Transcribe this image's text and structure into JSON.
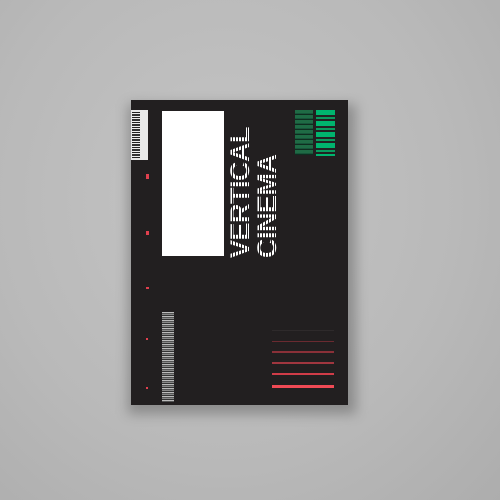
{
  "cover": {
    "title_line1": "VERTICAL",
    "title_line2": "CINEMA"
  },
  "colors": {
    "cover": "#221f20",
    "accent_red": "#e0404e",
    "accent_green": "#00b46e",
    "background": "#bdbdbd"
  }
}
